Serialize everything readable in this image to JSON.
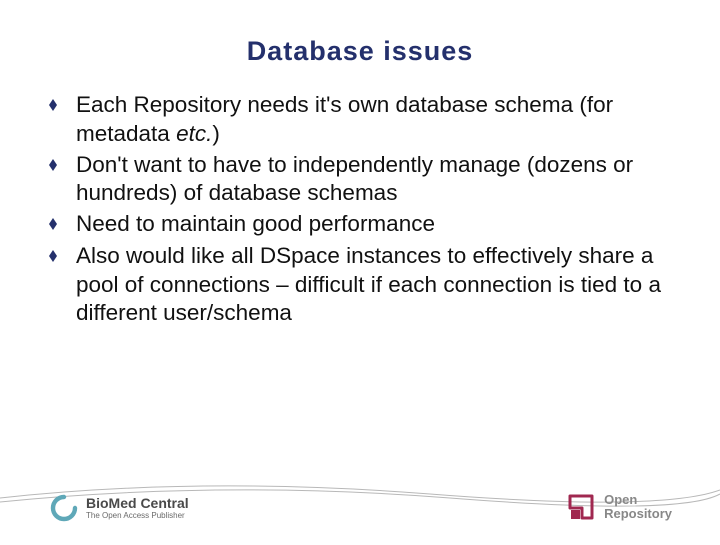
{
  "title": "Database  issues",
  "bullets": [
    {
      "pre": "Each Repository needs it's own database schema (for metadata ",
      "em": "etc.",
      "post": ")"
    },
    {
      "pre": "Don't want to have to independently manage (dozens or hundreds) of database schemas",
      "em": "",
      "post": ""
    },
    {
      "pre": "Need to maintain good performance",
      "em": "",
      "post": ""
    },
    {
      "pre": "Also would like all DSpace instances to effectively share a pool of connections – difficult if each connection is tied to a different user/schema",
      "em": "",
      "post": ""
    }
  ],
  "logos": {
    "left": {
      "main": "BioMed Central",
      "sub": "The Open Access Publisher"
    },
    "right": {
      "line1": "Open",
      "line2": "Repository"
    }
  },
  "colors": {
    "accent": "#24306c",
    "open_repo": "#a02850"
  }
}
